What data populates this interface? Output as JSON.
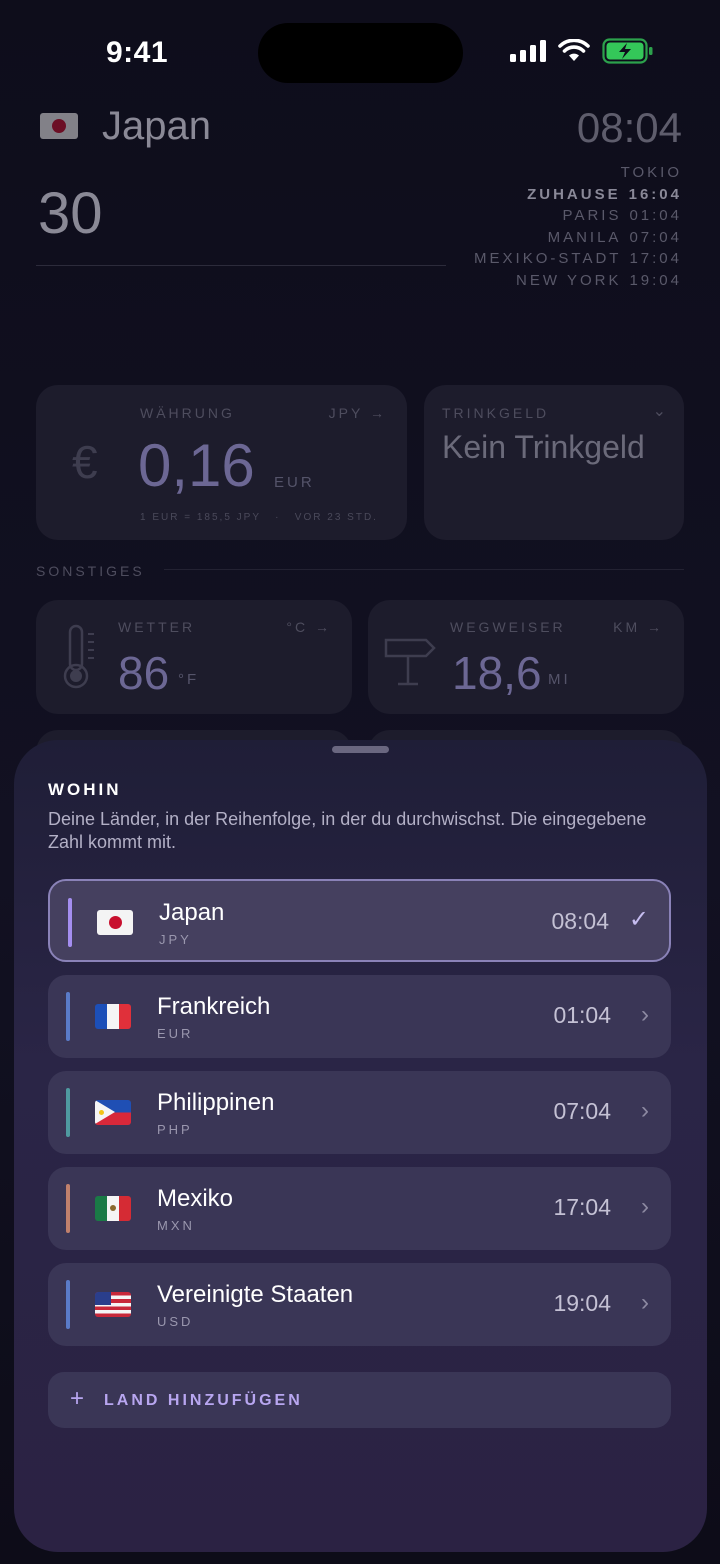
{
  "status_bar": {
    "time": "9:41"
  },
  "header": {
    "country": "Japan",
    "amount": "30",
    "local_time": "08:04",
    "zones": [
      {
        "city": "TOKIO",
        "time": "",
        "home": false
      },
      {
        "city": "ZUHAUSE",
        "time": "16:04",
        "home": true
      },
      {
        "city": "PARIS",
        "time": "01:04",
        "home": false
      },
      {
        "city": "MANILA",
        "time": "07:04",
        "home": false
      },
      {
        "city": "MEXIKO-STADT",
        "time": "17:04",
        "home": false
      },
      {
        "city": "NEW YORK",
        "time": "19:04",
        "home": false
      }
    ]
  },
  "currency_card": {
    "label": "WÄHRUNG",
    "code": "JPY",
    "symbol": "€",
    "value": "0,16",
    "unit": "EUR",
    "footnote": "1 EUR = 185,5 JPY   ·   VOR 23 STD."
  },
  "tip_card": {
    "label": "TRINKGELD",
    "value": "Kein Trinkgeld"
  },
  "section_label": "SONSTIGES",
  "weather_card": {
    "label": "WETTER",
    "alt_unit": "°C",
    "value": "86",
    "unit": "°F"
  },
  "distance_card": {
    "label": "WEGWEISER",
    "alt_unit": "KM",
    "value": "18,6",
    "unit": "MI"
  },
  "sheet": {
    "title": "WOHIN",
    "description": "Deine Länder, in der Reihenfolge, in der du durchwischst. Die eingegebene Zahl kommt mit.",
    "countries": [
      {
        "name": "Japan",
        "code": "JPY",
        "time": "08:04",
        "selected": true,
        "accent": "#a48ef0",
        "flag": "jp"
      },
      {
        "name": "Frankreich",
        "code": "EUR",
        "time": "01:04",
        "selected": false,
        "accent": "#5a7bc8",
        "flag": "fr"
      },
      {
        "name": "Philippinen",
        "code": "PHP",
        "time": "07:04",
        "selected": false,
        "accent": "#4f9aa0",
        "flag": "ph"
      },
      {
        "name": "Mexiko",
        "code": "MXN",
        "time": "17:04",
        "selected": false,
        "accent": "#c0806c",
        "flag": "mx"
      },
      {
        "name": "Vereinigte Staaten",
        "code": "USD",
        "time": "19:04",
        "selected": false,
        "accent": "#5a7bc8",
        "flag": "us"
      }
    ],
    "add_button": "LAND HINZUFÜGEN",
    "selected_mark": "✓",
    "chevron": "›"
  }
}
